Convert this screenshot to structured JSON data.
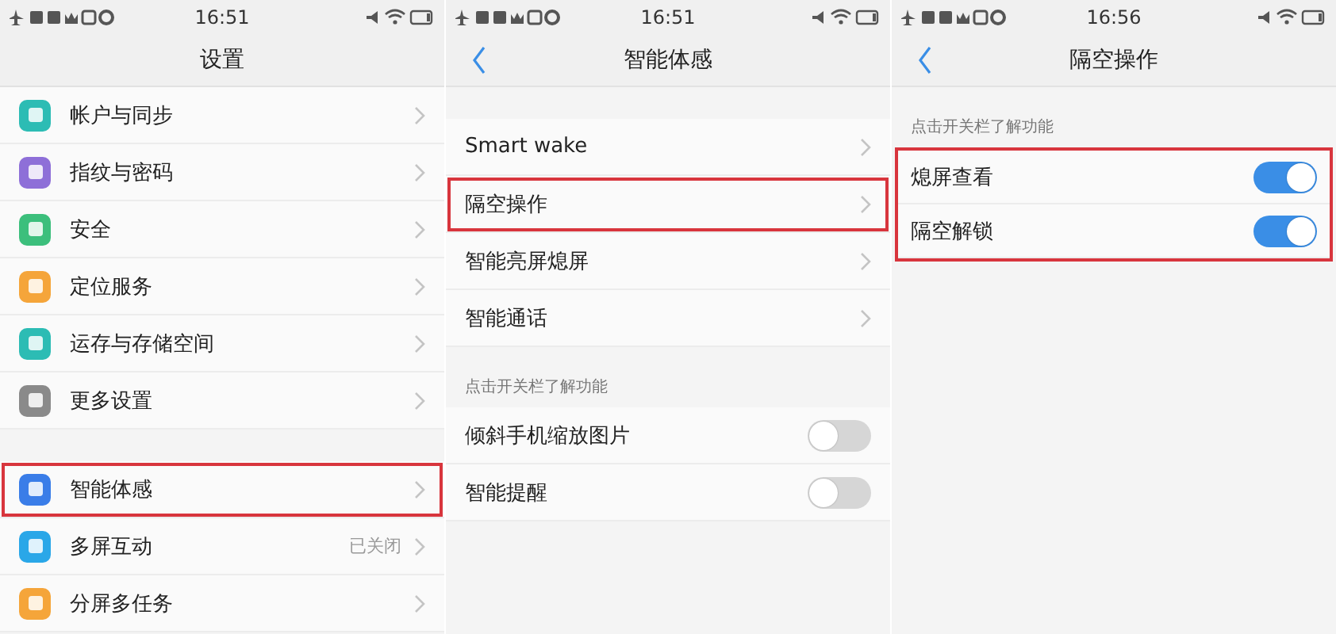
{
  "screens": [
    {
      "status_bar": {
        "time": "16:51"
      },
      "title": "设置",
      "back": false,
      "sections": [
        {
          "highlighted": false,
          "rows": [
            {
              "kind": "link",
              "label": "帐户与同步",
              "color": "#2cbcb4",
              "highlighted": false
            },
            {
              "kind": "link",
              "label": "指纹与密码",
              "color": "#8e6fd8",
              "highlighted": false
            },
            {
              "kind": "link",
              "label": "安全",
              "color": "#3cbf7c",
              "highlighted": false
            },
            {
              "kind": "link",
              "label": "定位服务",
              "color": "#f5a53a",
              "highlighted": false
            },
            {
              "kind": "link",
              "label": "运存与存储空间",
              "color": "#2cbcb4",
              "highlighted": false
            },
            {
              "kind": "link",
              "label": "更多设置",
              "color": "#8a8a8a",
              "highlighted": false
            }
          ]
        },
        {
          "highlighted": false,
          "rows": [
            {
              "kind": "link",
              "label": "智能体感",
              "color": "#3a7de8",
              "highlighted": true
            },
            {
              "kind": "link",
              "label": "多屏互动",
              "color": "#2aa7e8",
              "value": "已关闭",
              "highlighted": false
            },
            {
              "kind": "link",
              "label": "分屏多任务",
              "color": "#f5a53a",
              "highlighted": false
            }
          ]
        }
      ]
    },
    {
      "status_bar": {
        "time": "16:51"
      },
      "title": "智能体感",
      "back": true,
      "sections": [
        {
          "highlighted": false,
          "rows": [
            {
              "kind": "link",
              "label": "Smart wake",
              "highlighted": false
            },
            {
              "kind": "link",
              "label": "隔空操作",
              "highlighted": true
            },
            {
              "kind": "link",
              "label": "智能亮屏熄屏",
              "highlighted": false
            },
            {
              "kind": "link",
              "label": "智能通话",
              "highlighted": false
            }
          ]
        },
        {
          "header": "点击开关栏了解功能",
          "highlighted": false,
          "rows": [
            {
              "kind": "switch",
              "label": "倾斜手机缩放图片",
              "on": false,
              "highlighted": false
            },
            {
              "kind": "switch",
              "label": "智能提醒",
              "on": false,
              "highlighted": false
            }
          ]
        }
      ]
    },
    {
      "status_bar": {
        "time": "16:56"
      },
      "title": "隔空操作",
      "back": true,
      "sections": [
        {
          "header": "点击开关栏了解功能",
          "highlighted": true,
          "rows": [
            {
              "kind": "switch",
              "label": "熄屏查看",
              "on": true,
              "highlighted": false
            },
            {
              "kind": "switch",
              "label": "隔空解锁",
              "on": true,
              "highlighted": false
            }
          ]
        }
      ]
    }
  ]
}
